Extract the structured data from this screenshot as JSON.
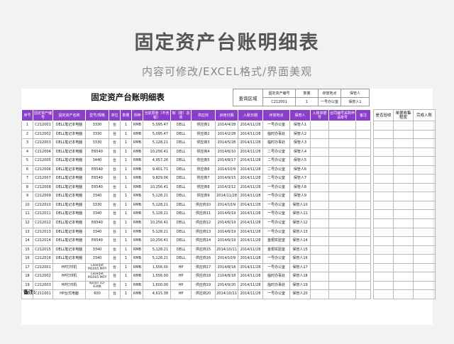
{
  "page": {
    "title": "固定资产台账明细表",
    "subtitle": "内容可修改/EXCEL格式/界面美观"
  },
  "sheet": {
    "title": "固定资产台账明细表",
    "remarks_label": "备注:"
  },
  "query": {
    "label": "查询区域",
    "headers": [
      "固定资产编号",
      "数量",
      "存放地点",
      "保管人"
    ],
    "values": [
      "C212001",
      "1",
      "一号办公室",
      "保管人1"
    ]
  },
  "columns": [
    "序号",
    "固定资产编号",
    "固定资产名称",
    "型号/规格",
    "单位",
    "数量",
    "币种",
    "当前原值（不含税）",
    "制（建）造商",
    "供应商",
    "启用日期",
    "入账日期",
    "存放地点",
    "保管人",
    "入账单据号",
    "合同编号采购申请单号",
    "备注"
  ],
  "extra_columns": [
    "是否验收",
    "单据收集程度",
    "完成入账"
  ],
  "rows": [
    [
      "1",
      "C212001",
      "DELL笔记本电脑",
      "3330",
      "台",
      "1",
      "RMB",
      "5,095.47",
      "DELL",
      "供应商1",
      "2014/4/28",
      "2014/11/28",
      "一号办公室",
      "保管人1"
    ],
    [
      "2",
      "C212002",
      "DELL笔记本电脑",
      "3330",
      "台",
      "1",
      "RMB",
      "5,095.47",
      "DELL",
      "供应商2",
      "2014/2/28",
      "2014/11/28",
      "临时办事处",
      "保管人2"
    ],
    [
      "3",
      "C212003",
      "DELL笔记本电脑",
      "3330",
      "台",
      "1",
      "RMB",
      "5,128.21",
      "DELL",
      "供应商3",
      "2014/5/28",
      "2014/11/28",
      "临时办事处",
      "保管人3"
    ],
    [
      "4",
      "C212004",
      "DELL笔记本电脑",
      "E6540",
      "台",
      "1",
      "RMB",
      "10,256.41",
      "DELL",
      "供应商4",
      "2014/6/10",
      "2014/11/28",
      "二号办公室",
      "保管人4"
    ],
    [
      "5",
      "C212005",
      "DELL笔记本电脑",
      "3440",
      "台",
      "1",
      "RMB",
      "4,957.26",
      "DELL",
      "供应商5",
      "2014/8/17",
      "2014/11/28",
      "二号办公室",
      "保管人5"
    ],
    [
      "6",
      "C212006",
      "DELL笔记本电脑",
      "E6540",
      "台",
      "1",
      "RMB",
      "9,401.71",
      "DELL",
      "供应商6",
      "2014/10/9",
      "2014/11/28",
      "二号办公室",
      "保管人6"
    ],
    [
      "7",
      "C212007",
      "DELL笔记本电脑",
      "E6540",
      "台",
      "1",
      "RMB",
      "9,829.06",
      "DELL",
      "供应商7",
      "2014/9/15",
      "2014/11/28",
      "二号办公室",
      "保管人7"
    ],
    [
      "8",
      "C212008",
      "DELL笔记本电脑",
      "E6540",
      "台",
      "1",
      "RMB",
      "10,256.41",
      "DELL",
      "供应商8",
      "2014/3/12",
      "2014/11/28",
      "一号办公室",
      "保管人8"
    ],
    [
      "9",
      "C212009",
      "DELL笔记本电脑",
      "3340",
      "台",
      "1",
      "RMB",
      "5,128.21",
      "DELL",
      "供应商9",
      "2014/11/28",
      "2014/11/28",
      "一号办公室",
      "保管人9"
    ],
    [
      "10",
      "C212010",
      "DELL笔记本电脑",
      "3330",
      "台",
      "1",
      "RMB",
      "5,128.21",
      "DELL",
      "供应商10",
      "2014/10/9",
      "2014/11/28",
      "一号办公室",
      "保管人10"
    ],
    [
      "11",
      "C212011",
      "DELL笔记本电脑",
      "3340",
      "台",
      "1",
      "RMB",
      "5,128.21",
      "DELL",
      "供应商11",
      "2014/6/19",
      "2014/11/28",
      "一号办公室",
      "保管人11"
    ],
    [
      "12",
      "C212012",
      "DELL笔记本电脑",
      "E6540",
      "台",
      "1",
      "RMB",
      "10,256.41",
      "DELL",
      "供应商12",
      "2014/6/19",
      "2014/11/28",
      "一号办公室",
      "保管人12"
    ],
    [
      "13",
      "C212013",
      "DELL笔记本电脑",
      "3340",
      "台",
      "1",
      "RMB",
      "5,128.21",
      "DELL",
      "供应商13",
      "2014/6/19",
      "2014/11/28",
      "一号办公室",
      "保管人13"
    ],
    [
      "14",
      "C212014",
      "DELL笔记本电脑",
      "E6540",
      "台",
      "1",
      "RMB",
      "10,256.41",
      "DELL",
      "供应商14",
      "2014/6/19",
      "2014/11/28",
      "金桐实验室",
      "保管人14"
    ],
    [
      "15",
      "C212015",
      "DELL笔记本电脑",
      "3340",
      "台",
      "1",
      "RMB",
      "5,128.21",
      "DELL",
      "供应商15",
      "2014/10/11",
      "2014/11/28",
      "金桐实验室",
      "保管人15"
    ],
    [
      "16",
      "C212016",
      "DELL笔记本电脑",
      "3340",
      "台",
      "1",
      "RMB",
      "5,128.21",
      "DELL",
      "供应商16",
      "2014/10/9",
      "2014/11/28",
      "一号办公室",
      "保管人16"
    ],
    [
      "17",
      "C212001",
      "HP打印机",
      "LaserJet M1005 MFP",
      "台",
      "1",
      "RMB",
      "1,556.00",
      "HP",
      "供应商17",
      "2014/8/18",
      "2014/11/28",
      "一号办公室",
      "保管人17"
    ],
    [
      "18",
      "C212002",
      "HP打印机",
      "LaserJet M1005 MFP",
      "台",
      "1",
      "RMB",
      "1,556.00",
      "HP",
      "供应商18",
      "2104/8/18",
      "2014/11/28",
      "临时办事处",
      "保管人18"
    ],
    [
      "19",
      "C212003",
      "HP打印机",
      "epson LQ-630K",
      "台",
      "1",
      "RMB",
      "1,600.00",
      "HP",
      "供应商19",
      "2014/9/20",
      "2014/11/28",
      "临时办事处",
      "保管人19"
    ],
    [
      "20",
      "C211001",
      "HP台式电脑",
      "600",
      "台",
      "1",
      "RMB",
      "4,615.38",
      "HP",
      "供应商20",
      "2014/10/11",
      "2014/11/28",
      "一号办公室",
      "保管人20"
    ]
  ],
  "colors": {
    "header_bg": "#8b3fc8",
    "header_text": "#ffffff",
    "background": "#f2f2f2"
  }
}
